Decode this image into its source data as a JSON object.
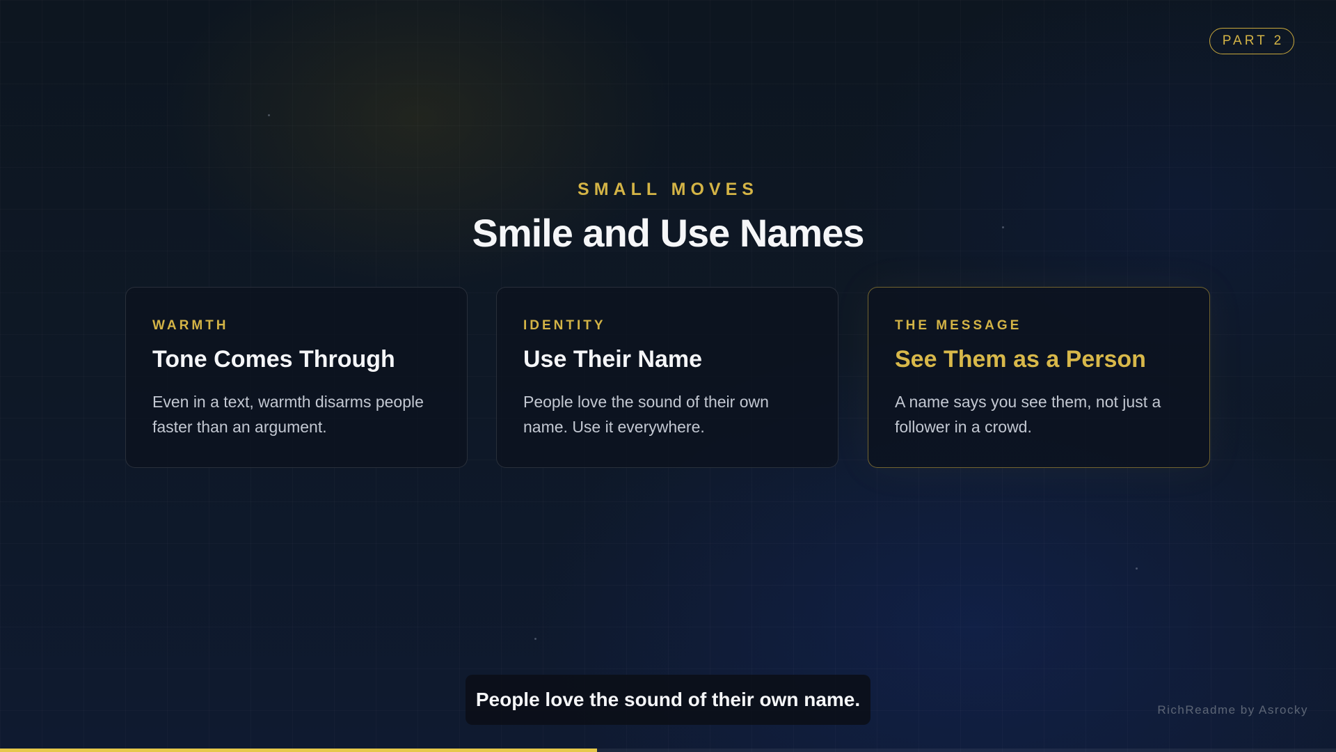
{
  "badge": {
    "label": "PART 2"
  },
  "header": {
    "kicker": "SMALL MOVES",
    "title": "Smile and Use Names"
  },
  "cards": [
    {
      "kicker": "WARMTH",
      "title": "Tone Comes Through",
      "body": "Even in a text, warmth disarms people faster than an argument.",
      "highlighted": false
    },
    {
      "kicker": "IDENTITY",
      "title": "Use Their Name",
      "body": "People love the sound of their own name. Use it everywhere.",
      "highlighted": false
    },
    {
      "kicker": "THE MESSAGE",
      "title": "See Them as a Person",
      "body": "A name says you see them, not just a follower in a crowd.",
      "highlighted": true
    }
  ],
  "caption": {
    "text": "People love the sound of their own name."
  },
  "credit": {
    "text": "RichReadme by Asrocky"
  },
  "progress": {
    "fraction": 0.447
  },
  "colors": {
    "accent": "#d4b446",
    "background": "#0c1420",
    "card_background": "#0c121e",
    "text_primary": "#f5f6f8",
    "text_secondary": "#c3c8d2"
  }
}
